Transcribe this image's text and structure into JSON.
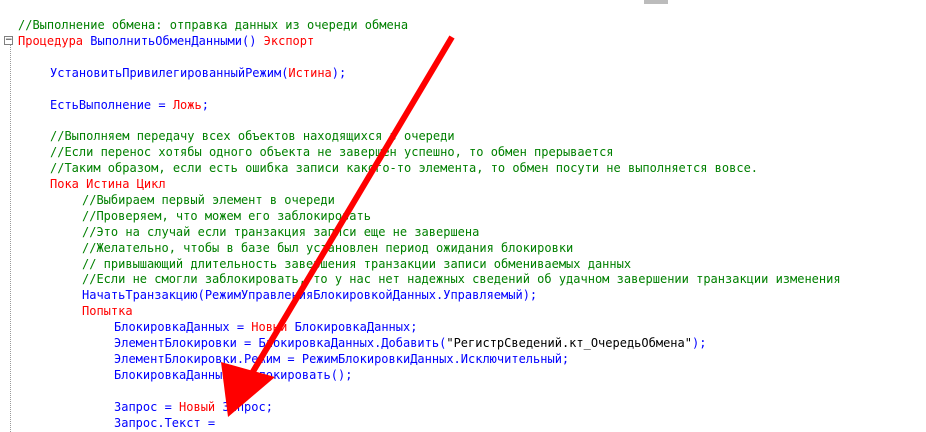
{
  "editor": {
    "lines": [
      {
        "indent": 0,
        "tokens": [
          {
            "t": "//Выполнение обмена: отправка данных из очереди обмена",
            "c": "comment"
          }
        ]
      },
      {
        "indent": 0,
        "tokens": [
          {
            "t": "Процедура",
            "c": "keyword"
          },
          {
            "t": " ВыполнитьОбменДанными() ",
            "c": "ident"
          },
          {
            "t": "Экспорт",
            "c": "keyword"
          }
        ]
      },
      {
        "indent": 0,
        "tokens": []
      },
      {
        "indent": 1,
        "tokens": [
          {
            "t": "УстановитьПривилегированныйРежим(",
            "c": "ident"
          },
          {
            "t": "Истина",
            "c": "keyword"
          },
          {
            "t": ");",
            "c": "ident"
          }
        ]
      },
      {
        "indent": 0,
        "tokens": []
      },
      {
        "indent": 1,
        "tokens": [
          {
            "t": "ЕстьВыполнение = ",
            "c": "ident"
          },
          {
            "t": "Ложь",
            "c": "keyword"
          },
          {
            "t": ";",
            "c": "ident"
          }
        ]
      },
      {
        "indent": 0,
        "tokens": []
      },
      {
        "indent": 1,
        "tokens": [
          {
            "t": "//Выполняем передачу всех объектов находящихся в очереди",
            "c": "comment"
          }
        ]
      },
      {
        "indent": 1,
        "tokens": [
          {
            "t": "//Если перенос хотябы одного объекта не завершен успешно, то обмен прерывается",
            "c": "comment"
          }
        ]
      },
      {
        "indent": 1,
        "tokens": [
          {
            "t": "//Таким образом, если есть ошибка записи какого-то элемента, то обмен посути не выполняется вовсе.",
            "c": "comment"
          }
        ]
      },
      {
        "indent": 1,
        "tokens": [
          {
            "t": "Пока Истина Цикл",
            "c": "keyword"
          }
        ]
      },
      {
        "indent": 2,
        "tokens": [
          {
            "t": "//Выбираем первый элемент в очереди",
            "c": "comment"
          }
        ]
      },
      {
        "indent": 2,
        "tokens": [
          {
            "t": "//Проверяем, что можем его заблокировать",
            "c": "comment"
          }
        ]
      },
      {
        "indent": 2,
        "tokens": [
          {
            "t": "//Это на случай если транзакция записи еще не завершена",
            "c": "comment"
          }
        ]
      },
      {
        "indent": 2,
        "tokens": [
          {
            "t": "//Желательно, чтобы в базе был установлен период ожидания блокировки",
            "c": "comment"
          }
        ]
      },
      {
        "indent": 2,
        "tokens": [
          {
            "t": "// привышающий длительность завершения транзакции записи обмениваемых данных",
            "c": "comment"
          }
        ]
      },
      {
        "indent": 2,
        "tokens": [
          {
            "t": "//Если не смогли заблокировать, то у нас нет надежных сведений об удачном завершении транзакции изменения",
            "c": "comment"
          }
        ]
      },
      {
        "indent": 2,
        "tokens": [
          {
            "t": "НачатьТранзакцию(РежимУправленияБлокировкойДанных.Управляемый);",
            "c": "ident"
          }
        ]
      },
      {
        "indent": 2,
        "tokens": [
          {
            "t": "Попытка",
            "c": "keyword"
          }
        ]
      },
      {
        "indent": 3,
        "tokens": [
          {
            "t": "БлокировкаДанных = ",
            "c": "ident"
          },
          {
            "t": "Новый",
            "c": "keyword"
          },
          {
            "t": " БлокировкаДанных;",
            "c": "ident"
          }
        ]
      },
      {
        "indent": 3,
        "tokens": [
          {
            "t": "ЭлементБлокировки = БлокировкаДанных.Добавить(",
            "c": "ident"
          },
          {
            "t": "\"РегистрСведений.кт_ОчередьОбмена\"",
            "c": "string"
          },
          {
            "t": ");",
            "c": "ident"
          }
        ]
      },
      {
        "indent": 3,
        "tokens": [
          {
            "t": "ЭлементБлокировки.Режим = РежимБлокировкиДанных.Исключительный;",
            "c": "ident"
          }
        ]
      },
      {
        "indent": 3,
        "tokens": [
          {
            "t": "БлокировкаДанных.Заблокировать();",
            "c": "ident"
          }
        ]
      },
      {
        "indent": 0,
        "tokens": []
      },
      {
        "indent": 3,
        "tokens": [
          {
            "t": "Запрос = ",
            "c": "ident"
          },
          {
            "t": "Новый",
            "c": "keyword"
          },
          {
            "t": " Запрос;",
            "c": "ident"
          }
        ]
      },
      {
        "indent": 3,
        "tokens": [
          {
            "t": "Запрос.Текст =",
            "c": "ident"
          }
        ]
      }
    ]
  },
  "colors": {
    "comment": "#008000",
    "keyword": "#ff0000",
    "identifier": "#0000ff",
    "arrow": "#ff0000"
  },
  "icons": {
    "fold": "collapse-minus-icon",
    "annotation": "red-arrow-icon"
  }
}
